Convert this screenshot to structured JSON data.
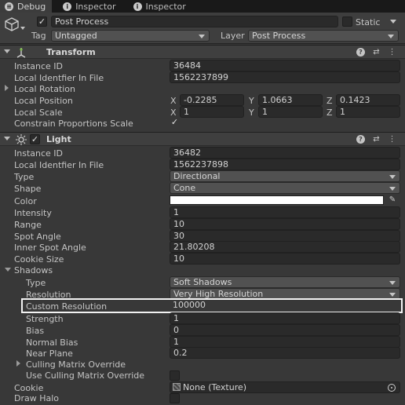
{
  "tabs": [
    {
      "label": "Debug",
      "icon": "info-icon",
      "active": true
    },
    {
      "label": "Inspector",
      "icon": "info-icon",
      "active": false
    },
    {
      "label": "Inspector",
      "icon": "info-icon",
      "active": false
    }
  ],
  "header": {
    "object_name": "Post Process",
    "static_label": "Static",
    "tag_label": "Tag",
    "tag_value": "Untagged",
    "layer_label": "Layer",
    "layer_value": "Post Process"
  },
  "transform": {
    "title": "Transform",
    "rows": {
      "instance_id_label": "Instance ID",
      "instance_id_value": "36484",
      "local_id_label": "Local Identfier In File",
      "local_id_value": "1562237899",
      "local_rotation_label": "Local Rotation",
      "local_position_label": "Local Position",
      "pos_x": "-0.2285",
      "pos_y": "1.0663",
      "pos_z": "0.1423",
      "local_scale_label": "Local Scale",
      "scale_x": "1",
      "scale_y": "1",
      "scale_z": "1",
      "constrain_label": "Constrain Proportions Scale"
    }
  },
  "axis_labels": {
    "x": "X",
    "y": "Y",
    "z": "Z"
  },
  "light": {
    "title": "Light",
    "instance_id_label": "Instance ID",
    "instance_id_value": "36482",
    "local_id_label": "Local Identfier In File",
    "local_id_value": "1562237898",
    "type_label": "Type",
    "type_value": "Directional",
    "shape_label": "Shape",
    "shape_value": "Cone",
    "color_label": "Color",
    "color_value": "#ffffff",
    "intensity_label": "Intensity",
    "intensity_value": "1",
    "range_label": "Range",
    "range_value": "10",
    "spot_angle_label": "Spot Angle",
    "spot_angle_value": "30",
    "inner_spot_label": "Inner Spot Angle",
    "inner_spot_value": "21.80208",
    "cookie_size_label": "Cookie Size",
    "cookie_size_value": "10",
    "shadows_label": "Shadows",
    "shadow_type_label": "Type",
    "shadow_type_value": "Soft Shadows",
    "resolution_label": "Resolution",
    "resolution_value": "Very High Resolution",
    "custom_res_label": "Custom Resolution",
    "custom_res_value": "100000",
    "strength_label": "Strength",
    "strength_value": "1",
    "bias_label": "Bias",
    "bias_value": "0",
    "normal_bias_label": "Normal Bias",
    "normal_bias_value": "1",
    "near_plane_label": "Near Plane",
    "near_plane_value": "0.2",
    "culling_override_label": "Culling Matrix Override",
    "use_culling_label": "Use Culling Matrix Override",
    "cookie_label": "Cookie",
    "cookie_value": "None (Texture)",
    "draw_halo_label": "Draw Halo"
  }
}
